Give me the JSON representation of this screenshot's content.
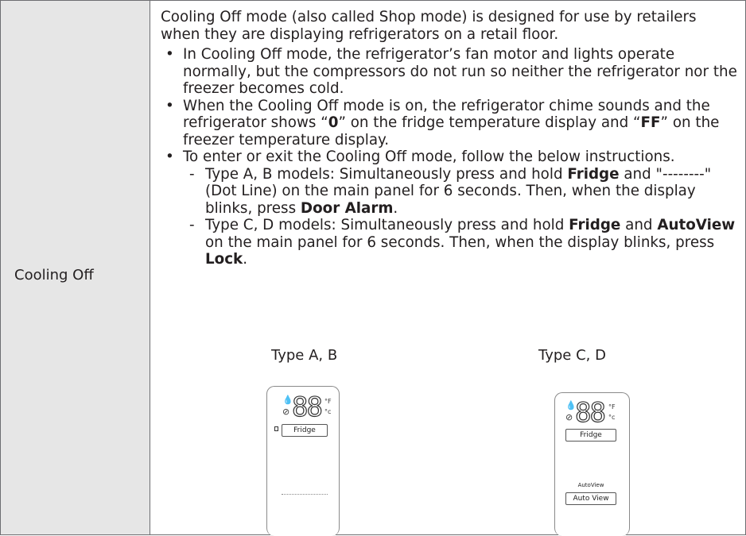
{
  "row": {
    "label": "Cooling Off"
  },
  "intro": "Cooling Off mode (also called Shop mode) is designed for use by retailers when they are displaying refrigerators on a retail floor.",
  "bullet1": "In Cooling Off mode, the refrigerator’s fan motor and lights operate normally, but the compressors do not run so neither the refrigerator nor the freezer becomes cold.",
  "bullet2": {
    "t1": "When the Cooling Off mode is on, the refrigerator chime sounds and the refrigerator shows “",
    "b1": "0",
    "t2": "” on the fridge temperature display and “",
    "b2": "FF",
    "t3": "” on the freezer temperature display."
  },
  "bullet3": "To enter or exit the Cooling Off mode, follow the below instructions.",
  "sub1": {
    "t1": "Type A, B models: Simultaneously press and hold ",
    "b1": "Fridge",
    "t2": " and \"--------\" (Dot Line) on the main panel for 6 seconds. Then, when the display blinks, press ",
    "b2": "Door Alarm",
    "t3": "."
  },
  "sub2": {
    "t1": "Type C, D models: Simultaneously press and hold ",
    "b1": "Fridge",
    "t2": " and ",
    "b2": "AutoView",
    "t3": " on the main panel for 6 seconds. Then, when the display blinks, press ",
    "b3": "Lock",
    "t4": "."
  },
  "figures": {
    "left_label": "Type A, B",
    "right_label": "Type C, D",
    "digits": "88",
    "unit_f": "°F",
    "unit_c": "°c",
    "fridge_button": "Fridge",
    "autoview_caption": "AutoView",
    "autoview_button": "Auto View"
  }
}
